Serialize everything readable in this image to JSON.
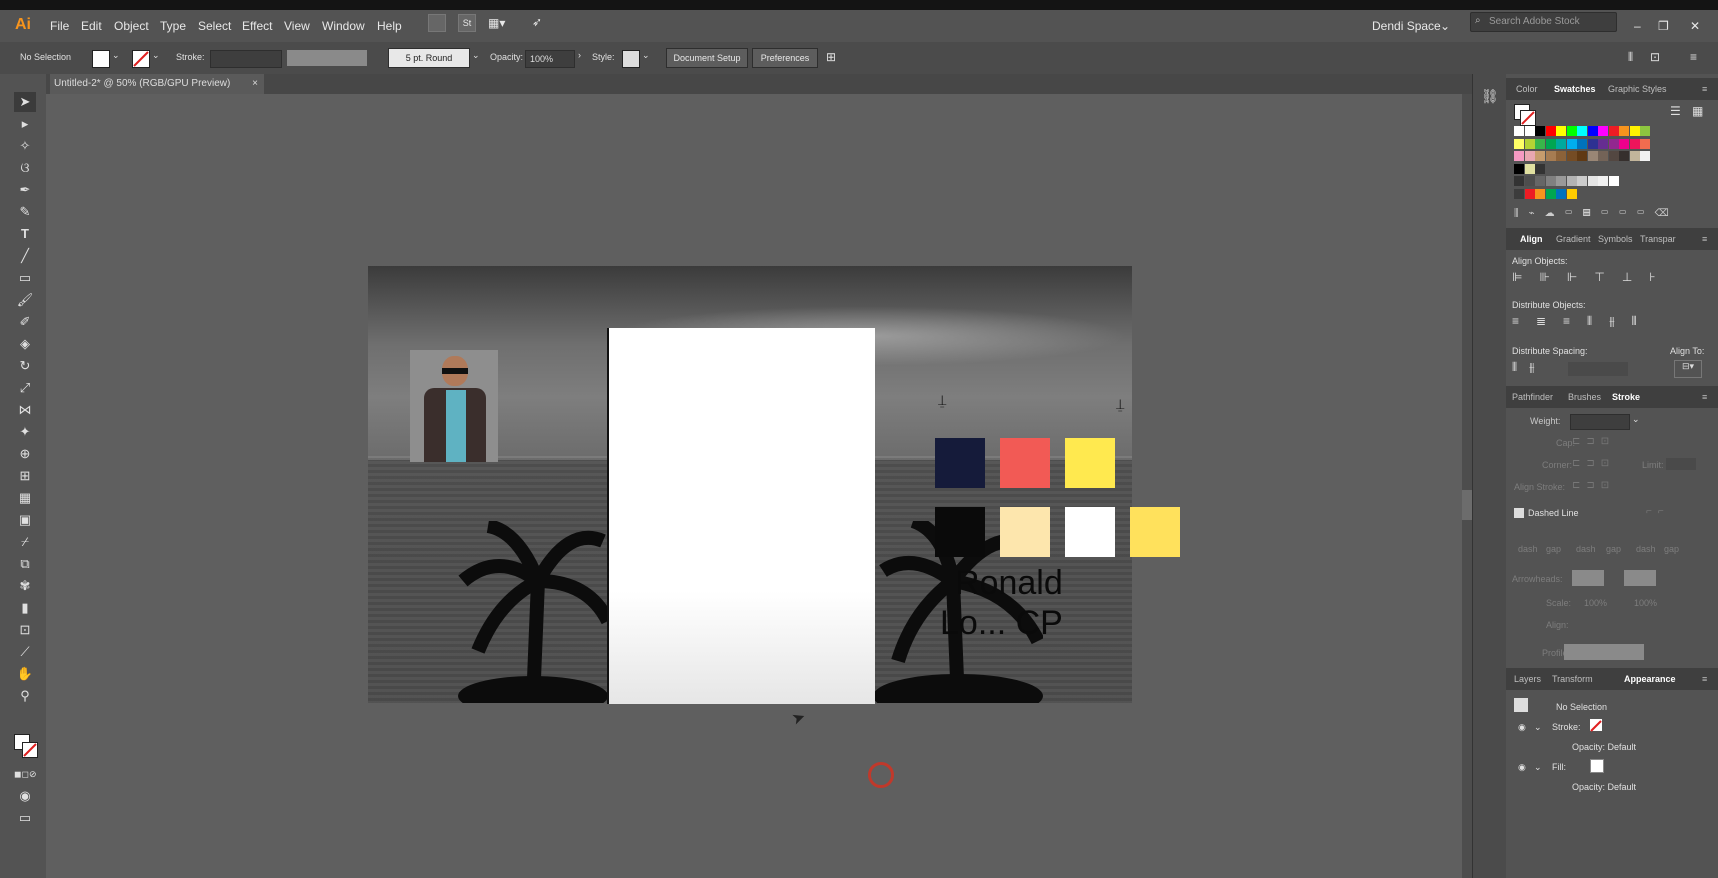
{
  "app": {
    "logo": "Ai",
    "workspace": "Dendi Space",
    "search_placeholder": "Search Adobe Stock"
  },
  "menu": [
    "File",
    "Edit",
    "Object",
    "Type",
    "Select",
    "Effect",
    "View",
    "Window",
    "Help"
  ],
  "control_bar": {
    "selection": "No Selection",
    "stroke_label": "Stroke:",
    "brush": "5 pt. Round",
    "opacity_label": "Opacity:",
    "opacity_value": "100%",
    "style_label": "Style:",
    "document_setup": "Document Setup",
    "preferences": "Preferences"
  },
  "document_tab": {
    "title": "Untitled-2* @ 50% (RGB/GPU Preview)",
    "close": "×"
  },
  "artwork": {
    "text_line1": "Ronald",
    "text_line2": "Lo... CP",
    "swatch_colors": [
      "#151b3a",
      "#f25a55",
      "#ffe94f",
      "#0a0a0a",
      "#fde6ad",
      "#ffffff",
      "#ffe15c"
    ]
  },
  "panels": {
    "color_tabs": [
      "Color",
      "Swatches",
      "Graphic Styles"
    ],
    "align_tabs": [
      "Align",
      "Gradient",
      "Symbols",
      "Transpar"
    ],
    "align_objects": "Align Objects:",
    "distribute_objects": "Distribute Objects:",
    "distribute_spacing": "Distribute Spacing:",
    "align_to": "Align To:",
    "stroke_tabs": [
      "Pathfinder",
      "Brushes",
      "Stroke"
    ],
    "stroke": {
      "weight": "Weight:",
      "cap": "Cap:",
      "corner": "Corner:",
      "limit": "Limit:",
      "align_stroke": "Align Stroke:",
      "dashed_line": "Dashed Line",
      "dash_labels": [
        "dash",
        "gap",
        "dash",
        "gap",
        "dash",
        "gap"
      ],
      "arrowheads": "Arrowheads:",
      "scale": "Scale:",
      "scale_value": "100%",
      "align": "Align:",
      "profile": "Profile:"
    },
    "appearance_tabs": [
      "Layers",
      "Transform",
      "Appearance"
    ],
    "appearance": {
      "selection": "No Selection",
      "stroke": "Stroke:",
      "opacity1": "Opacity: Default",
      "fill": "Fill:",
      "opacity2": "Opacity: Default"
    }
  },
  "swatch_grid": [
    [
      "#ffffff",
      "#ffffff",
      "#000000",
      "#ff0000",
      "#ffff00",
      "#00ff00",
      "#00ffff",
      "#0000ff",
      "#ff00ff",
      "#ed1c24",
      "#f7941d",
      "#fff200",
      "#8dc63f"
    ],
    [
      "#ffff66",
      "#b5d334",
      "#39b54a",
      "#00a651",
      "#00a99d",
      "#00aeef",
      "#0072bc",
      "#2e3192",
      "#662d91",
      "#92278f",
      "#ec008c",
      "#ed145b",
      "#f26c4f"
    ],
    [
      "#f49ac2",
      "#e8a7b1",
      "#c69c6d",
      "#a67c52",
      "#8c6239",
      "#754c24",
      "#603913",
      "#998675",
      "#736357",
      "#534741",
      "#362f2d",
      "#c2b59b",
      "#f2f2f2"
    ],
    [
      "#000000",
      "#e0e0a0",
      "#333333"
    ],
    [
      "#333333",
      "#4d4d4d",
      "#666666",
      "#808080",
      "#999999",
      "#b3b3b3",
      "#cccccc",
      "#e6e6e6",
      "#f2f2f2",
      "#ffffff"
    ],
    [
      "#3c3c3c",
      "#ed1c24",
      "#f7941d",
      "#00a651",
      "#0072bc",
      "#ffcc00"
    ]
  ]
}
